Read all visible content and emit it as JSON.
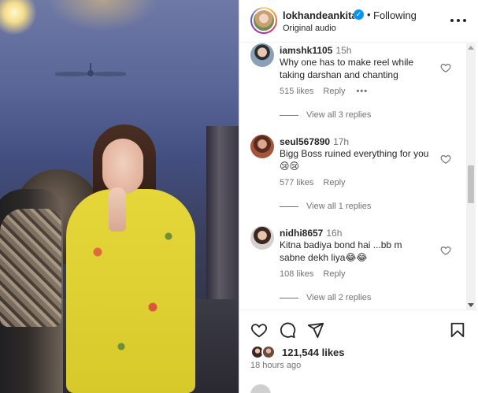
{
  "post": {
    "author": "lokhandeankita",
    "separator": "•",
    "follow_status": "Following",
    "audio": "Original audio",
    "verified_mark": "✓"
  },
  "comments": [
    {
      "user": "iamshk1105",
      "time": "15h",
      "text": "Why one has to make reel while taking darshan and chanting",
      "likes": "515 likes",
      "reply": "Reply",
      "more": "•••",
      "view_replies": "View all 3 replies"
    },
    {
      "user": "seul567890",
      "time": "17h",
      "text": "Bigg Boss ruined everything for you😢😢",
      "likes": "577 likes",
      "reply": "Reply",
      "view_replies": "View all 1 replies"
    },
    {
      "user": "nidhi8657",
      "time": "16h",
      "text": "Kitna badiya bond hai ...bb m sabne dekh liya😂😂",
      "likes": "108 likes",
      "reply": "Reply",
      "view_replies": "View all 2 replies"
    }
  ],
  "footer": {
    "likes_count": "121,544 likes",
    "time_ago": "18 hours ago"
  },
  "icons": {
    "like": "heart-icon",
    "comment": "comment-icon",
    "share": "share-icon",
    "save": "bookmark-icon",
    "more": "more-options-icon",
    "verified": "verified-badge-icon"
  },
  "colors": {
    "text": "#262626",
    "secondary": "#737373",
    "verified": "#0095f6",
    "dress_yellow": "#e5d63a"
  }
}
